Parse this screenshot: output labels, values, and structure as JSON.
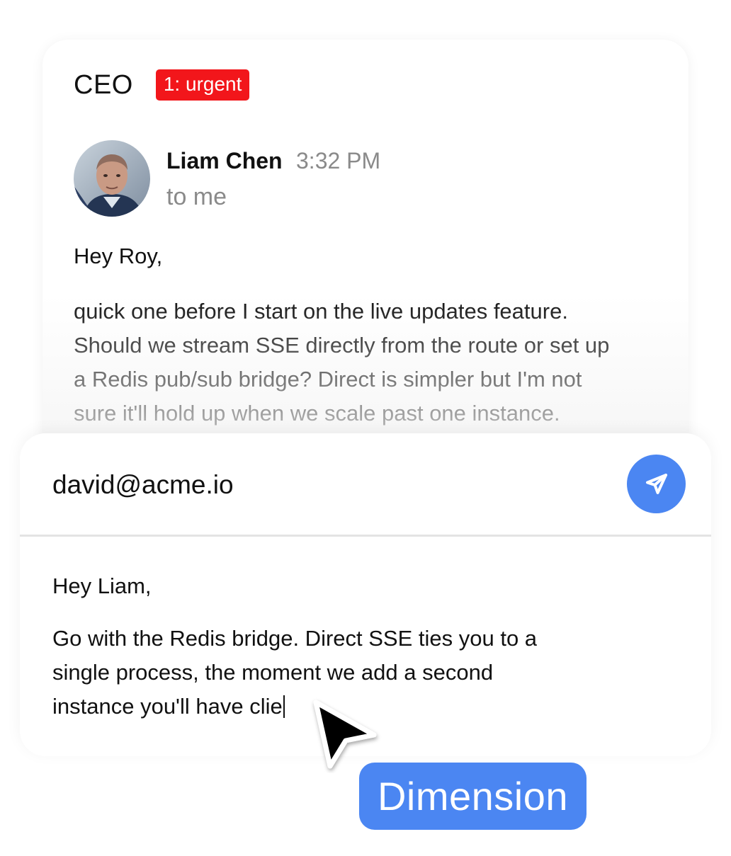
{
  "email": {
    "subject": "CEO",
    "badge": "1: urgent",
    "sender": {
      "name": "Liam Chen",
      "time": "3:32 PM",
      "recipient": "to me",
      "avatar_icon": "person-avatar"
    },
    "greeting": "Hey Roy,",
    "body_lines": [
      "quick one before I start on the live updates feature.",
      "Should we stream SSE directly from the route or set up",
      "a Redis pub/sub bridge? Direct is simpler but I'm not",
      "sure it'll hold up when we scale past one instance."
    ]
  },
  "reply": {
    "to": "david@acme.io",
    "send_icon": "send-icon",
    "greeting": "Hey Liam,",
    "body_lines": [
      "Go with the Redis bridge. Direct SSE ties you to a",
      "single process, the moment we add a second",
      "instance you'll have clie"
    ]
  },
  "cursor_label": "Dimension",
  "colors": {
    "badge": "#f2161b",
    "accent": "#4b86f2",
    "muted_text": "#8a8a8a"
  }
}
